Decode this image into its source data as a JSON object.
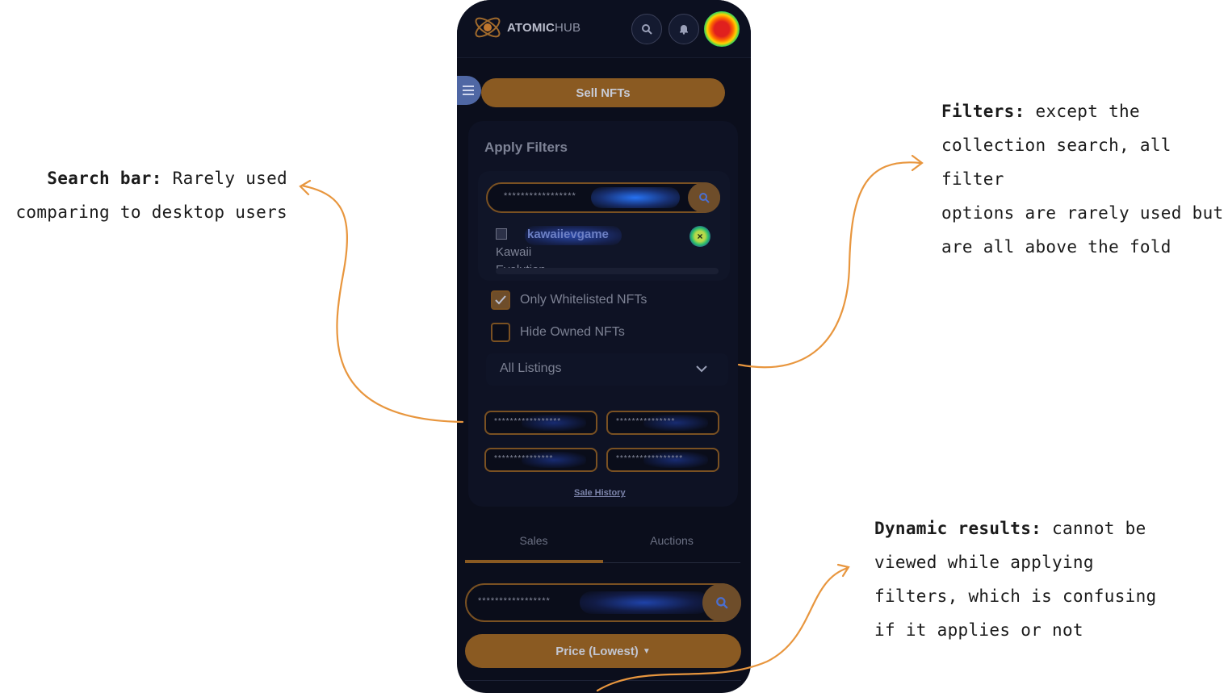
{
  "annotations": {
    "search_bar": {
      "title": "Search bar:",
      "line1": "Rarely used",
      "line2": "comparing to desktop users"
    },
    "filters": {
      "title": "Filters:",
      "line1": "except the",
      "line2": "collection search, all filter",
      "line3": "options are rarely used but",
      "line4": "are all above the fold"
    },
    "dynamic_results": {
      "title": "Dynamic results:",
      "line1": "cannot be",
      "line2": "viewed while applying",
      "line3": "filters, which is confusing",
      "line4": "if it applies or not"
    }
  },
  "header": {
    "logo_bold": "ATOMIC",
    "logo_thin": "HUB"
  },
  "sell_button": "Sell NFTs",
  "filters": {
    "title": "Apply Filters",
    "collection_search_placeholder": "*****************",
    "collection_alt_line1": "Kawaii",
    "collection_alt_line2": "Evolution",
    "collection_name": "kawaiievgame",
    "only_whitelisted": {
      "label": "Only Whitelisted NFTs",
      "checked": true
    },
    "hide_owned": {
      "label": "Hide Owned NFTs",
      "checked": false
    },
    "listing_select": "All Listings",
    "fields": [
      "*****************",
      "***************",
      "***************",
      "*****************"
    ],
    "sale_history": "Sale History"
  },
  "tabs": [
    {
      "label": "Sales",
      "active": true
    },
    {
      "label": "Auctions",
      "active": false
    }
  ],
  "results": {
    "search_placeholder": "*****************",
    "sort_label": "Price (Lowest)"
  },
  "colors": {
    "accent": "#8a5a22",
    "background": "#0b0e1c",
    "annotation_arrow": "#e8963e"
  }
}
